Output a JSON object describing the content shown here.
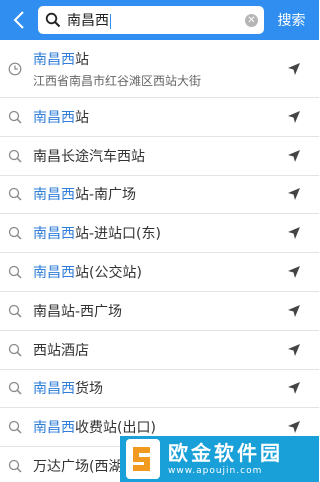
{
  "header": {
    "back_icon": "chevron-left-icon",
    "search_query": "南昌西",
    "search_button": "搜索",
    "accent_color": "#2f8ef0"
  },
  "results": [
    {
      "type": "history",
      "highlight": "南昌西",
      "rest": "站",
      "subtitle": "江西省南昌市红谷滩区西站大街"
    },
    {
      "type": "search",
      "highlight": "南昌西",
      "rest": "站"
    },
    {
      "type": "search",
      "highlight": "",
      "rest": "南昌长途汽车西站"
    },
    {
      "type": "search",
      "highlight": "南昌西",
      "rest": "站-南广场"
    },
    {
      "type": "search",
      "highlight": "南昌西",
      "rest": "站-进站口(东)"
    },
    {
      "type": "search",
      "highlight": "南昌西",
      "rest": "站(公交站)"
    },
    {
      "type": "search",
      "highlight": "",
      "rest": "南昌站-西广场"
    },
    {
      "type": "search",
      "highlight": "",
      "rest": "西站酒店"
    },
    {
      "type": "search",
      "highlight": "南昌西",
      "rest": "货场"
    },
    {
      "type": "search",
      "highlight": "南昌西",
      "rest": "收费站(出口)"
    },
    {
      "type": "search",
      "highlight": "",
      "rest": "万达广场(西湖"
    }
  ],
  "watermark": {
    "title": "欧金软件园",
    "url": "www.apoujin.com"
  }
}
